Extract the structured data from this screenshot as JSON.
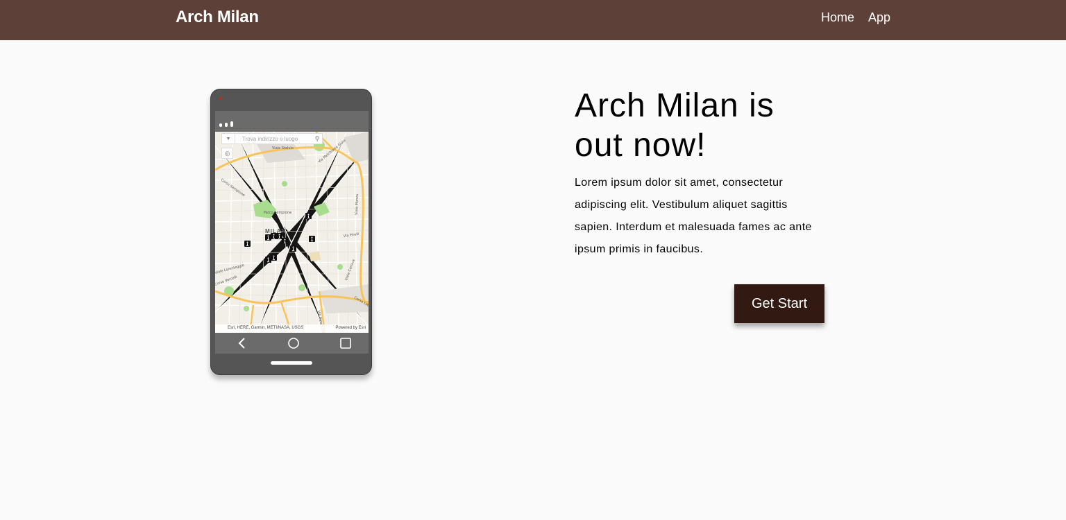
{
  "header": {
    "brand": "Arch Milan",
    "nav": [
      {
        "label": "Home"
      },
      {
        "label": "App"
      }
    ]
  },
  "phone": {
    "map": {
      "search_placeholder": "Trova indirizzo o luogo",
      "city_label": "MILAN",
      "attribution_left": "Esri, HERE, Garmin, METI/NASA, USGS",
      "attribution_right": "Powered by Esri"
    }
  },
  "hero": {
    "title": "Arch Milan is out now!",
    "body": "Lorem ipsum dolor sit amet, consectetur adipiscing elit. Vestibulum aliquet sagittis sapien. Interdum et malesuada fames ac ante ipsum primis in faucibus.",
    "cta_label": "Get Start"
  },
  "colors": {
    "header_bg": "#5d4037",
    "cta_bg": "#321911",
    "page_bg": "#fafafa"
  }
}
